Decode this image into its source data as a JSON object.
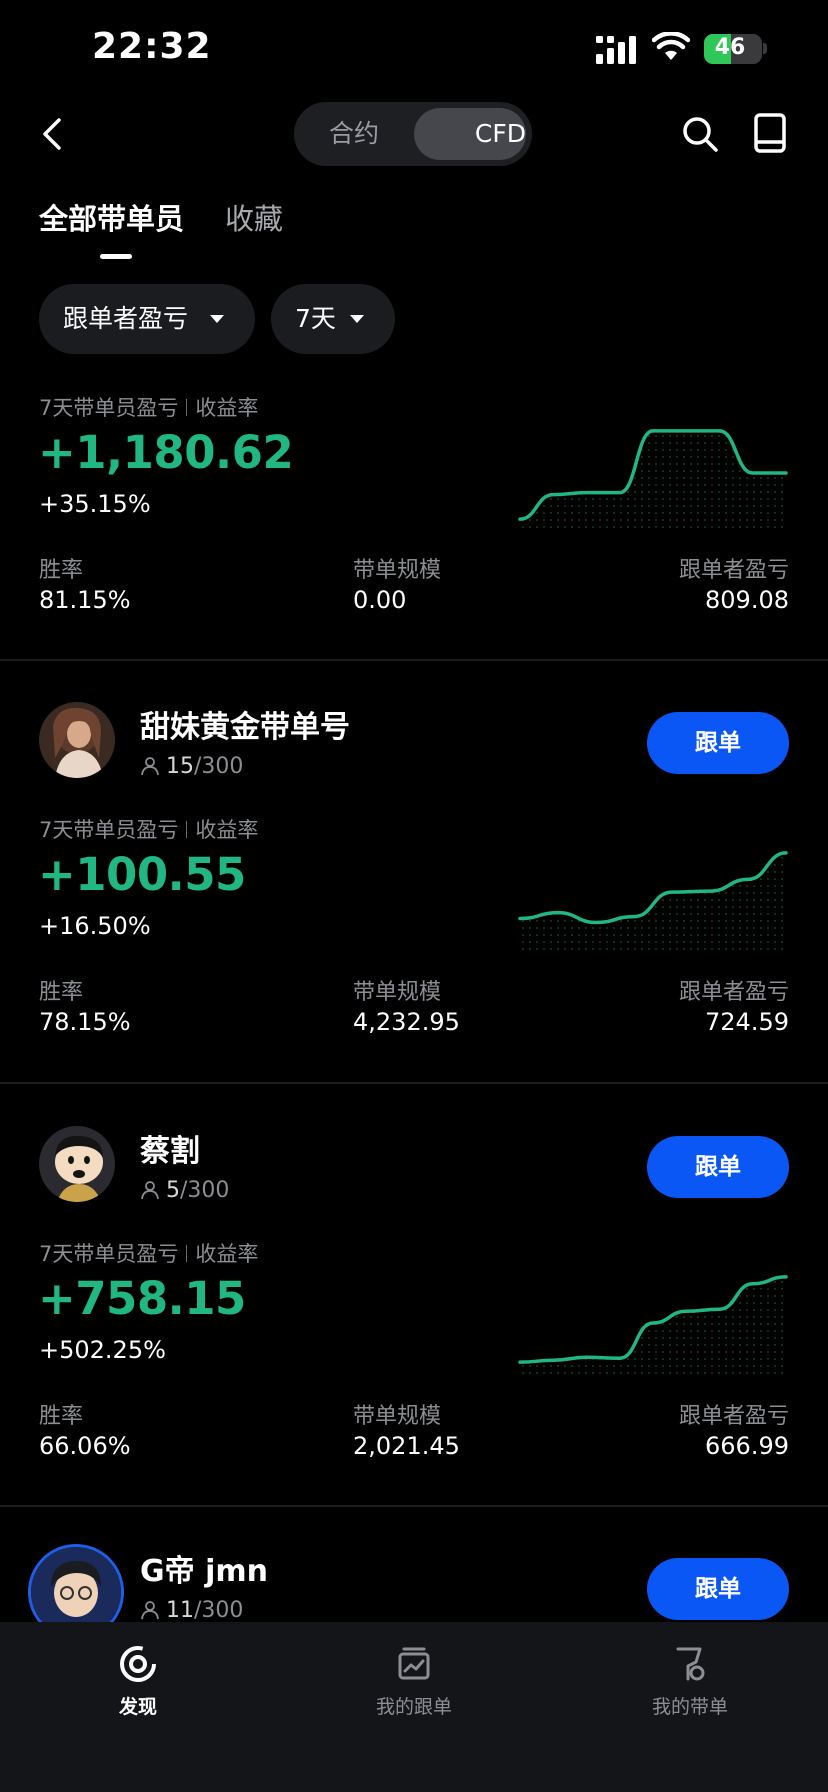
{
  "status_bar": {
    "time": "22:32",
    "battery_text": "46",
    "battery_level": 0.46,
    "icons": [
      "signal-icon",
      "wifi-icon",
      "battery-icon"
    ]
  },
  "nav": {
    "back_icon": "chevron-left-icon",
    "segments": [
      "合约",
      "CFD"
    ],
    "selected_segment": "CFD",
    "search_icon": "search-icon",
    "book_icon": "book-icon"
  },
  "tabs": [
    {
      "label": "全部带单员",
      "active": true
    },
    {
      "label": "收藏",
      "active": false
    }
  ],
  "filters": {
    "sort_label": "跟单者盈亏",
    "period_label": "7天"
  },
  "colors": {
    "positive": "#21b782",
    "primary_button": "#0b57f5",
    "background": "#000000"
  },
  "labels": {
    "pnl_caption": "7天带单员盈亏",
    "rate_caption": "收益率",
    "win_rate": "胜率",
    "scale": "带单规模",
    "follower_pnl": "跟单者盈亏",
    "follow_button": "跟单"
  },
  "summary": {
    "pnl": "+1,180.62",
    "rate": "+35.15%",
    "win_rate": "81.15%",
    "scale": "0.00",
    "follower_pnl": "809.08",
    "trend": [
      0.05,
      0.3,
      0.32,
      0.32,
      0.95,
      0.95,
      0.95,
      0.52,
      0.52
    ]
  },
  "traders": [
    {
      "name": "甜妹黄金带单号",
      "followers_current": "15",
      "followers_max": "/300",
      "pnl": "+100.55",
      "rate": "+16.50%",
      "win_rate": "78.15%",
      "scale": "4,232.95",
      "follower_pnl": "724.59",
      "trend": [
        0.28,
        0.34,
        0.24,
        0.3,
        0.55,
        0.56,
        0.68,
        0.95
      ]
    },
    {
      "name": "蔡割",
      "followers_current": "5",
      "followers_max": "/300",
      "pnl": "+758.15",
      "rate": "+502.25%",
      "win_rate": "66.06%",
      "scale": "2,021.45",
      "follower_pnl": "666.99",
      "trend": [
        0.08,
        0.1,
        0.13,
        0.12,
        0.48,
        0.6,
        0.62,
        0.88,
        0.95
      ]
    },
    {
      "name": "G帝 jmn",
      "followers_current": "11",
      "followers_max": "/300"
    }
  ],
  "bottom_nav": [
    {
      "label": "发现",
      "icon": "discover-icon",
      "active": true
    },
    {
      "label": "我的跟单",
      "icon": "copy-trade-icon",
      "active": false
    },
    {
      "label": "我的带单",
      "icon": "lead-trade-icon",
      "active": false
    }
  ]
}
